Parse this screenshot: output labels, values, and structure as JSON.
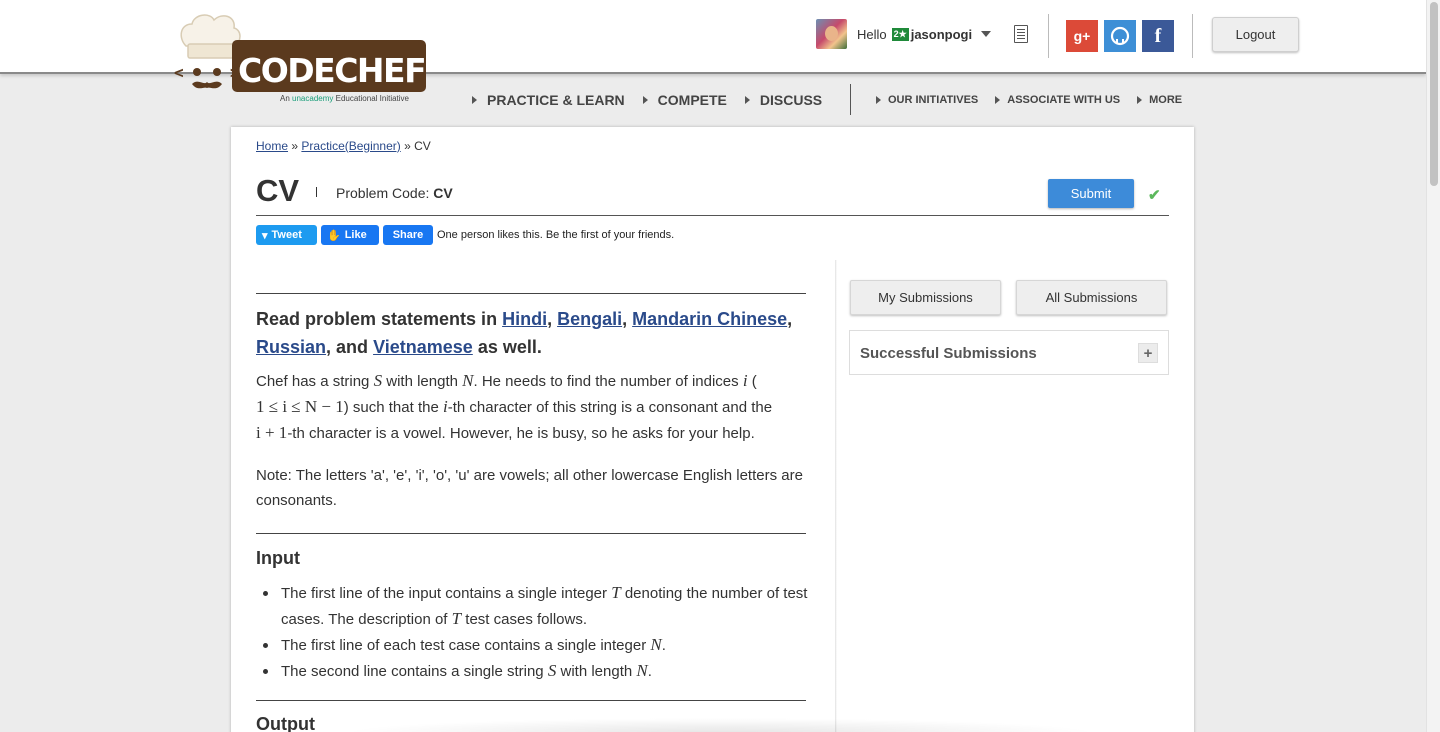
{
  "header": {
    "logo_text": "CODECHEF",
    "logo_tagline_prefix": "An",
    "logo_tagline_brand": "unacademy",
    "logo_tagline_suffix": "Educational Initiative",
    "greeting": "Hello",
    "rating_badge": "2★",
    "username": "jasonpogi",
    "logout_label": "Logout",
    "social": {
      "google_plus": "g+",
      "facebook": "f"
    }
  },
  "nav": {
    "main": [
      "PRACTICE & LEARN",
      "COMPETE",
      "DISCUSS"
    ],
    "secondary": [
      "OUR INITIATIVES",
      "ASSOCIATE WITH US",
      "MORE"
    ]
  },
  "breadcrumb": {
    "home": "Home",
    "sep1": "»",
    "practice": "Practice(Beginner)",
    "sep2": "»",
    "current": "CV"
  },
  "problem": {
    "title": "CV",
    "code_label": "Problem Code:",
    "code": "CV",
    "submit_label": "Submit",
    "check_glyph": "✔"
  },
  "share": {
    "tweet": "Tweet",
    "like": "Like",
    "share": "Share",
    "likes_text": "One person likes this. Be the first of your friends."
  },
  "statement": {
    "langs_prefix": "Read problem statements in",
    "langs": [
      "Hindi",
      "Bengali",
      "Mandarin Chinese",
      "Russian",
      "Vietnamese"
    ],
    "langs_and": ", and",
    "langs_suffix": "as well.",
    "p1": {
      "a": "Chef has a string",
      "S": "S",
      "b": "with length",
      "N": "N",
      "c": ". He needs to find the number of indices",
      "i": "i",
      "d": "(",
      "range": "1 ≤ i ≤ N − 1",
      "e": ") such that the",
      "i2": "i",
      "f": "-th character of this string is a consonant and the",
      "ip1": "i + 1",
      "g": "-th character is a vowel. However, he is busy, so he asks for your help."
    },
    "note": "Note: The letters 'a', 'e', 'i', 'o', 'u' are vowels; all other lowercase English letters are consonants.",
    "input_heading": "Input",
    "input_items": [
      {
        "a": "The first line of the input contains a single integer",
        "v": "T",
        "b": "denoting the number of test cases. The description of",
        "v2": "T",
        "c": "test cases follows."
      },
      {
        "a": "The first line of each test case contains a single integer",
        "v": "N",
        "b": "."
      },
      {
        "a": "The second line contains a single string",
        "v": "S",
        "b": "with length",
        "v2": "N",
        "c": "."
      }
    ],
    "output_heading": "Output"
  },
  "sidebar": {
    "my_submissions": "My Submissions",
    "all_submissions": "All Submissions",
    "successful_submissions": "Successful Submissions",
    "expand_glyph": "+"
  },
  "colors": {
    "brand_brown": "#5b3a1e",
    "link": "#2a4a8a",
    "submit": "#3d8bd9",
    "success": "#5cb85c",
    "tweet": "#1d9bf0",
    "facebook": "#1877f2"
  }
}
